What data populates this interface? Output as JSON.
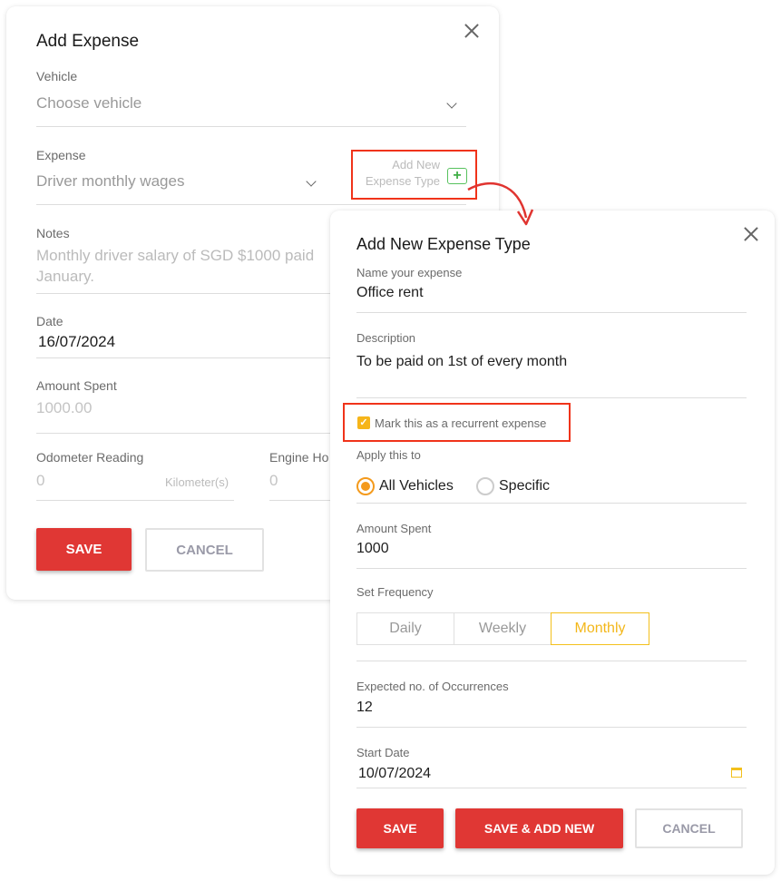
{
  "main_dialog": {
    "title": "Add Expense",
    "vehicle": {
      "label": "Vehicle",
      "placeholder": "Choose vehicle"
    },
    "expense": {
      "label": "Expense",
      "value": "Driver monthly wages"
    },
    "add_new_type": {
      "line1": "Add New",
      "line2": "Expense Type",
      "icon": "plus-icon"
    },
    "notes": {
      "label": "Notes",
      "line1": "Monthly driver salary of SGD $1000 paid",
      "line2": "January."
    },
    "date": {
      "label": "Date",
      "value": "16/07/2024"
    },
    "amount": {
      "label": "Amount Spent",
      "placeholder": "1000.00"
    },
    "odometer": {
      "label": "Odometer Reading",
      "value": "0",
      "unit": "Kilometer(s)"
    },
    "engine_hours": {
      "label": "Engine Ho",
      "value": "0"
    },
    "buttons": {
      "save": "SAVE",
      "cancel": "CANCEL"
    }
  },
  "sub_dialog": {
    "title": "Add New Expense Type",
    "name": {
      "label": "Name your expense",
      "value": "Office rent"
    },
    "description": {
      "label": "Description",
      "value": "To be paid on 1st of every month"
    },
    "recurrent": {
      "label": "Mark this as a recurrent expense",
      "checked": true
    },
    "apply_to": {
      "label": "Apply this to",
      "options": [
        "All Vehicles",
        "Specific"
      ],
      "selected": "All Vehicles"
    },
    "amount": {
      "label": "Amount Spent",
      "value": "1000"
    },
    "frequency": {
      "label": "Set Frequency",
      "options": [
        "Daily",
        "Weekly",
        "Monthly"
      ],
      "selected": "Monthly"
    },
    "occurrences": {
      "label": "Expected no. of Occurrences",
      "value": "12"
    },
    "start_date": {
      "label": "Start Date",
      "value": "10/07/2024",
      "icon": "calendar-icon"
    },
    "buttons": {
      "save": "SAVE",
      "save_add_new": "SAVE & ADD NEW",
      "cancel": "CANCEL"
    }
  },
  "colors": {
    "primary_red": "#e03734",
    "accent_yellow": "#f3c01c",
    "radio_orange": "#f49a1c",
    "highlight_red": "#f0331a",
    "plus_green": "#57c25e"
  }
}
